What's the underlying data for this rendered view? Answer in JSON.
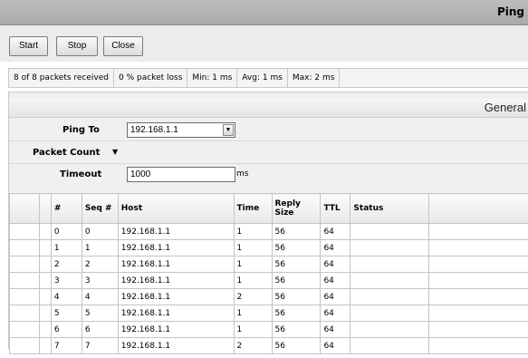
{
  "window": {
    "title": "Ping"
  },
  "toolbar": {
    "start_label": "Start",
    "stop_label": "Stop",
    "close_label": "Close"
  },
  "status": {
    "received": "8 of 8 packets received",
    "loss": "0 % packet loss",
    "min": "Min: 1 ms",
    "avg": "Avg: 1 ms",
    "max": "Max: 2 ms"
  },
  "section": {
    "title": "General"
  },
  "form": {
    "ping_to_label": "Ping To",
    "ping_to_value": "192.168.1.1",
    "packet_count_label": "Packet Count",
    "timeout_label": "Timeout",
    "timeout_value": "1000",
    "timeout_unit": "ms"
  },
  "table": {
    "headers": [
      "",
      "",
      "#",
      "Seq #",
      "Host",
      "Time",
      "Reply Size",
      "TTL",
      "Status",
      ""
    ],
    "rows": [
      [
        "0",
        "0",
        "192.168.1.1",
        "1",
        "56",
        "64"
      ],
      [
        "1",
        "1",
        "192.168.1.1",
        "1",
        "56",
        "64"
      ],
      [
        "2",
        "2",
        "192.168.1.1",
        "1",
        "56",
        "64"
      ],
      [
        "3",
        "3",
        "192.168.1.1",
        "1",
        "56",
        "64"
      ],
      [
        "4",
        "4",
        "192.168.1.1",
        "2",
        "56",
        "64"
      ],
      [
        "5",
        "5",
        "192.168.1.1",
        "1",
        "56",
        "64"
      ],
      [
        "6",
        "6",
        "192.168.1.1",
        "1",
        "56",
        "64"
      ],
      [
        "7",
        "7",
        "192.168.1.1",
        "2",
        "56",
        "64"
      ]
    ]
  }
}
